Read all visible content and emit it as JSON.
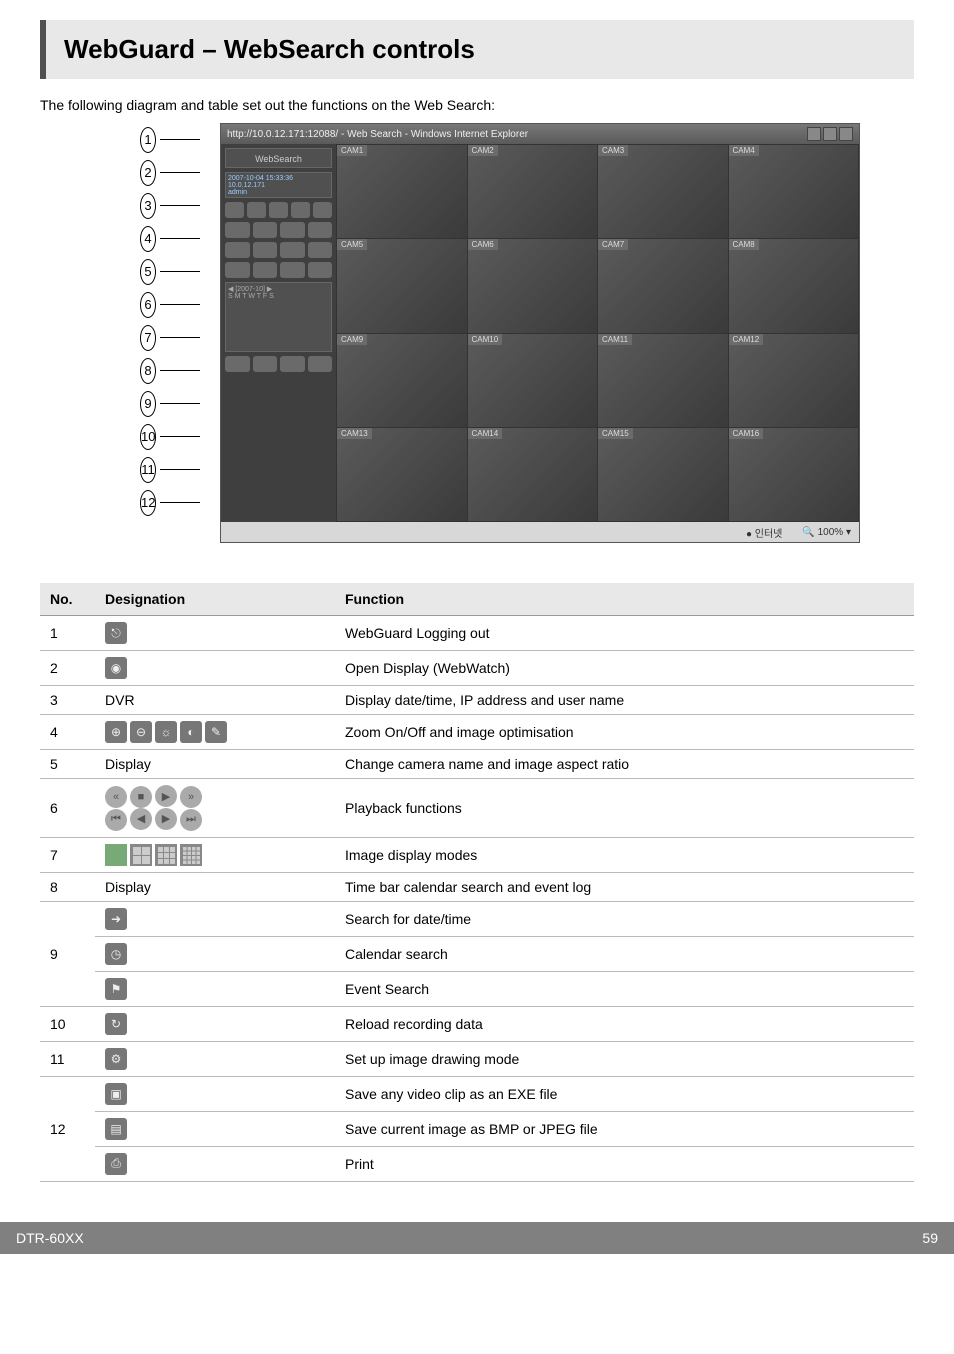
{
  "title": "WebGuard – WebSearch controls",
  "intro": "The following diagram and table set out the functions on the Web Search:",
  "browser_title": "http://10.0.12.171:12088/ - Web Search - Windows Internet Explorer",
  "sidebar": {
    "brand": "WebSearch",
    "datetime": "2007-10-04 15:33:36",
    "ip": "10.0.12.171",
    "user": "admin",
    "cal_month": "[2007-10]"
  },
  "cameras": [
    "CAM1",
    "CAM2",
    "CAM3",
    "CAM4",
    "CAM5",
    "CAM6",
    "CAM7",
    "CAM8",
    "CAM9",
    "CAM10",
    "CAM11",
    "CAM12",
    "CAM13",
    "CAM14",
    "CAM15",
    "CAM16"
  ],
  "status": {
    "internet": "인터넷",
    "zoom": "100%"
  },
  "callouts": [
    "1",
    "2",
    "3",
    "4",
    "5",
    "6",
    "7",
    "8",
    "9",
    "10",
    "11",
    "12"
  ],
  "table": {
    "headers": {
      "no": "No.",
      "des": "Designation",
      "fn": "Function"
    },
    "rows": [
      {
        "no": "1",
        "des_type": "icon",
        "icons": [
          "logout-icon"
        ],
        "fn": "WebGuard Logging out"
      },
      {
        "no": "2",
        "des_type": "icon",
        "icons": [
          "eye-icon"
        ],
        "fn": "Open Display (WebWatch)"
      },
      {
        "no": "3",
        "des_type": "text",
        "des": "DVR",
        "fn": "Display date/time, IP address and user name"
      },
      {
        "no": "4",
        "des_type": "toolbar4",
        "fn": "Zoom On/Off and image optimisation"
      },
      {
        "no": "5",
        "des_type": "text",
        "des": "Display",
        "fn": "Change camera name and image aspect ratio"
      },
      {
        "no": "6",
        "des_type": "playback",
        "fn": "Playback functions"
      },
      {
        "no": "7",
        "des_type": "layouts",
        "fn": "Image display modes"
      },
      {
        "no": "8",
        "des_type": "text",
        "des": "Display",
        "fn": "Time bar calendar search and event log"
      },
      {
        "no": "9a",
        "group": "9",
        "des_type": "icon",
        "icons": [
          "goto-icon"
        ],
        "fn": "Search for date/time"
      },
      {
        "no": "9b",
        "group": "9",
        "des_type": "icon",
        "icons": [
          "clock-icon"
        ],
        "fn": "Calendar search"
      },
      {
        "no": "9c",
        "group": "9",
        "des_type": "icon",
        "icons": [
          "event-icon"
        ],
        "fn": "Event Search"
      },
      {
        "no": "10",
        "des_type": "icon",
        "icons": [
          "reload-icon"
        ],
        "fn": "Reload recording data"
      },
      {
        "no": "11",
        "des_type": "icon",
        "icons": [
          "draw-mode-icon"
        ],
        "fn": "Set up image drawing mode"
      },
      {
        "no": "12a",
        "group": "12",
        "des_type": "icon",
        "icons": [
          "save-exe-icon"
        ],
        "fn": "Save any video clip as an EXE file"
      },
      {
        "no": "12b",
        "group": "12",
        "des_type": "icon",
        "icons": [
          "save-img-icon"
        ],
        "fn": "Save current image as BMP or JPEG file"
      },
      {
        "no": "12c",
        "group": "12",
        "des_type": "icon",
        "icons": [
          "print-icon"
        ],
        "fn": "Print"
      }
    ],
    "group_labels": {
      "9": "9",
      "12": "12"
    }
  },
  "icon_glyphs": {
    "logout-icon": "⎋",
    "eye-icon": "◉",
    "goto-icon": "➜",
    "clock-icon": "◷",
    "event-icon": "⚑",
    "reload-icon": "↻",
    "draw-mode-icon": "⚙",
    "save-exe-icon": "▣",
    "save-img-icon": "▤",
    "print-icon": "⎙",
    "zoom-in-icon": "⊕",
    "zoom-out-icon": "⊖",
    "bright-icon": "☼",
    "contrast-icon": "◐",
    "edit-icon": "✎"
  },
  "footer": {
    "model": "DTR-60XX",
    "page": "59"
  }
}
